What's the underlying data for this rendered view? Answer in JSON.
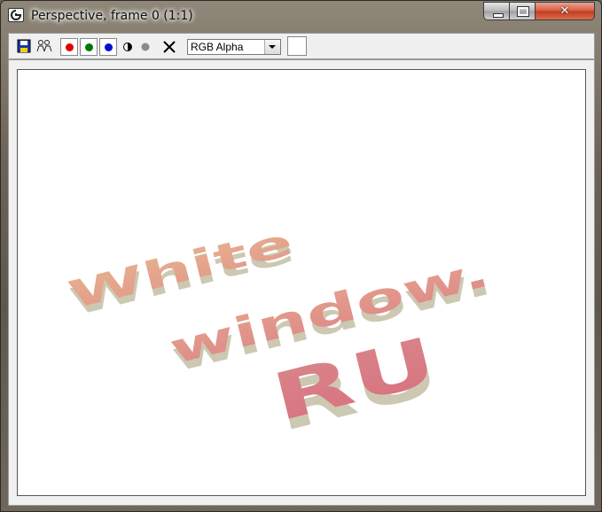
{
  "window": {
    "title": "Perspective, frame 0 (1:1)",
    "controls": {
      "close_glyph": "✕"
    }
  },
  "toolbar": {
    "channel_select": {
      "value": "RGB Alpha"
    },
    "channel_colors": {
      "red": "#e00000",
      "green": "#007a00",
      "blue": "#0010d0"
    }
  },
  "render": {
    "lines": [
      "White",
      "window.",
      "RU"
    ],
    "colors": {
      "top": "#e7a98f",
      "bottom": "#d77884",
      "side": "#d2cfba"
    }
  }
}
